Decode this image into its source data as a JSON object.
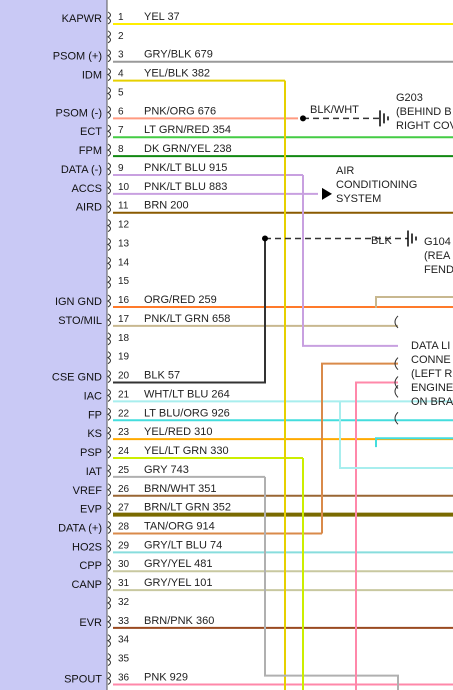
{
  "diagram": {
    "panel_color": "#c9c9f5",
    "pins": [
      {
        "pin": "1",
        "signal": "KAPWR",
        "wire_color": "YEL",
        "circuit": "37",
        "hex": "#ffee00"
      },
      {
        "pin": "2",
        "signal": "",
        "wire_color": "",
        "circuit": "",
        "hex": ""
      },
      {
        "pin": "3",
        "signal": "PSOM (+)",
        "wire_color": "GRY/BLK",
        "circuit": "679",
        "hex": "#9a9a9a"
      },
      {
        "pin": "4",
        "signal": "IDM",
        "wire_color": "YEL/BLK",
        "circuit": "382",
        "hex": "#e6d000"
      },
      {
        "pin": "5",
        "signal": "",
        "wire_color": "",
        "circuit": "",
        "hex": ""
      },
      {
        "pin": "6",
        "signal": "PSOM (-)",
        "wire_color": "PNK/ORG",
        "circuit": "676",
        "hex": "#ff9a80"
      },
      {
        "pin": "7",
        "signal": "ECT",
        "wire_color": "LT GRN/RED",
        "circuit": "354",
        "hex": "#44cc44"
      },
      {
        "pin": "8",
        "signal": "FPM",
        "wire_color": "DK GRN/YEL",
        "circuit": "238",
        "hex": "#118811"
      },
      {
        "pin": "9",
        "signal": "DATA (-)",
        "wire_color": "PNK/LT BLU",
        "circuit": "915",
        "hex": "#c8a0e0"
      },
      {
        "pin": "10",
        "signal": "ACCS",
        "wire_color": "PNK/LT BLU",
        "circuit": "883",
        "hex": "#c8a0e0"
      },
      {
        "pin": "11",
        "signal": "AIRD",
        "wire_color": "BRN",
        "circuit": "200",
        "hex": "#8a5a00"
      },
      {
        "pin": "12",
        "signal": "",
        "wire_color": "",
        "circuit": "",
        "hex": ""
      },
      {
        "pin": "13",
        "signal": "",
        "wire_color": "",
        "circuit": "",
        "hex": ""
      },
      {
        "pin": "14",
        "signal": "",
        "wire_color": "",
        "circuit": "",
        "hex": ""
      },
      {
        "pin": "15",
        "signal": "",
        "wire_color": "",
        "circuit": "",
        "hex": ""
      },
      {
        "pin": "16",
        "signal": "IGN GND",
        "wire_color": "ORG/RED",
        "circuit": "259",
        "hex": "#ff7a2a"
      },
      {
        "pin": "17",
        "signal": "STO/MIL",
        "wire_color": "PNK/LT GRN",
        "circuit": "658",
        "hex": "#c8b890"
      },
      {
        "pin": "18",
        "signal": "",
        "wire_color": "",
        "circuit": "",
        "hex": ""
      },
      {
        "pin": "19",
        "signal": "",
        "wire_color": "",
        "circuit": "",
        "hex": ""
      },
      {
        "pin": "20",
        "signal": "CSE GND",
        "wire_color": "BLK",
        "circuit": "57",
        "hex": "#333333"
      },
      {
        "pin": "21",
        "signal": "IAC",
        "wire_color": "WHT/LT BLU",
        "circuit": "264",
        "hex": "#a8eeee"
      },
      {
        "pin": "22",
        "signal": "FP",
        "wire_color": "LT BLU/ORG",
        "circuit": "926",
        "hex": "#44dddd"
      },
      {
        "pin": "23",
        "signal": "KS",
        "wire_color": "YEL/RED",
        "circuit": "310",
        "hex": "#ffaa00"
      },
      {
        "pin": "24",
        "signal": "PSP",
        "wire_color": "YEL/LT GRN",
        "circuit": "330",
        "hex": "#ccee00"
      },
      {
        "pin": "25",
        "signal": "IAT",
        "wire_color": "GRY",
        "circuit": "743",
        "hex": "#b0b0b0"
      },
      {
        "pin": "26",
        "signal": "VREF",
        "wire_color": "BRN/WHT",
        "circuit": "351",
        "hex": "#996633"
      },
      {
        "pin": "27",
        "signal": "EVP",
        "wire_color": "BRN/LT GRN",
        "circuit": "352",
        "hex": "#7a6a00"
      },
      {
        "pin": "28",
        "signal": "DATA (+)",
        "wire_color": "TAN/ORG",
        "circuit": "914",
        "hex": "#d98a4a"
      },
      {
        "pin": "29",
        "signal": "HO2S",
        "wire_color": "GRY/LT BLU",
        "circuit": "74",
        "hex": "#88dddd"
      },
      {
        "pin": "30",
        "signal": "CPP",
        "wire_color": "GRY/YEL",
        "circuit": "481",
        "hex": "#c8c8a0"
      },
      {
        "pin": "31",
        "signal": "CANP",
        "wire_color": "GRY/YEL",
        "circuit": "101",
        "hex": "#c8c8a0"
      },
      {
        "pin": "32",
        "signal": "",
        "wire_color": "",
        "circuit": "",
        "hex": ""
      },
      {
        "pin": "33",
        "signal": "EVR",
        "wire_color": "BRN/PNK",
        "circuit": "360",
        "hex": "#9a4a20"
      },
      {
        "pin": "34",
        "signal": "",
        "wire_color": "",
        "circuit": "",
        "hex": ""
      },
      {
        "pin": "35",
        "signal": "",
        "wire_color": "",
        "circuit": "",
        "hex": ""
      },
      {
        "pin": "36",
        "signal": "SPOUT",
        "wire_color": "PNK",
        "circuit": "929",
        "hex": "#ff88aa"
      }
    ],
    "ground_g203": {
      "wire_label": "BLK/WHT",
      "lines": [
        "G203",
        "(BEHIND B",
        "RIGHT COV"
      ]
    },
    "ground_g104": {
      "wire_label": "BLK",
      "lines": [
        "G104",
        "(REA",
        "FEND"
      ]
    },
    "ac_system": {
      "lines": [
        "AIR",
        "CONDITIONING",
        "SYSTEM"
      ]
    },
    "data_link": {
      "lines": [
        "DATA LI",
        "CONNE",
        "(LEFT R",
        "ENGINE",
        "ON BRA"
      ]
    }
  }
}
